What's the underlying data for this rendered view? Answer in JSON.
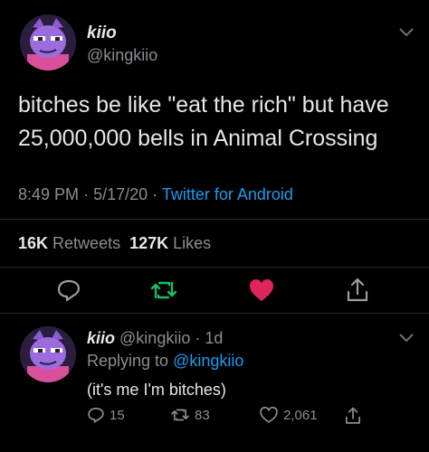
{
  "tweet": {
    "display_name": "kiio",
    "handle": "@kingkiio",
    "text": "bitches be like \"eat the rich\" but have 25,000,000 bells in Animal Crossing",
    "time": "8:49 PM",
    "date": "5/17/20",
    "separator": "·",
    "source": "Twitter for Android",
    "retweet_count": "16K",
    "retweet_label": "Retweets",
    "like_count": "127K",
    "like_label": "Likes",
    "icons": [
      "reply-icon",
      "retweet-icon",
      "like-icon",
      "share-icon"
    ],
    "colors": {
      "retweet": "#17bf63",
      "like": "#e0245e",
      "link": "#1d9bf0"
    }
  },
  "reply": {
    "display_name": "kiio",
    "handle": "@kingkiio",
    "age": "1d",
    "separator": "·",
    "replying_label": "Replying to",
    "replying_to": "@kingkiio",
    "text": "(it's me I'm bitches)",
    "reply_count": "15",
    "retweet_count": "83",
    "like_count": "2,061"
  }
}
